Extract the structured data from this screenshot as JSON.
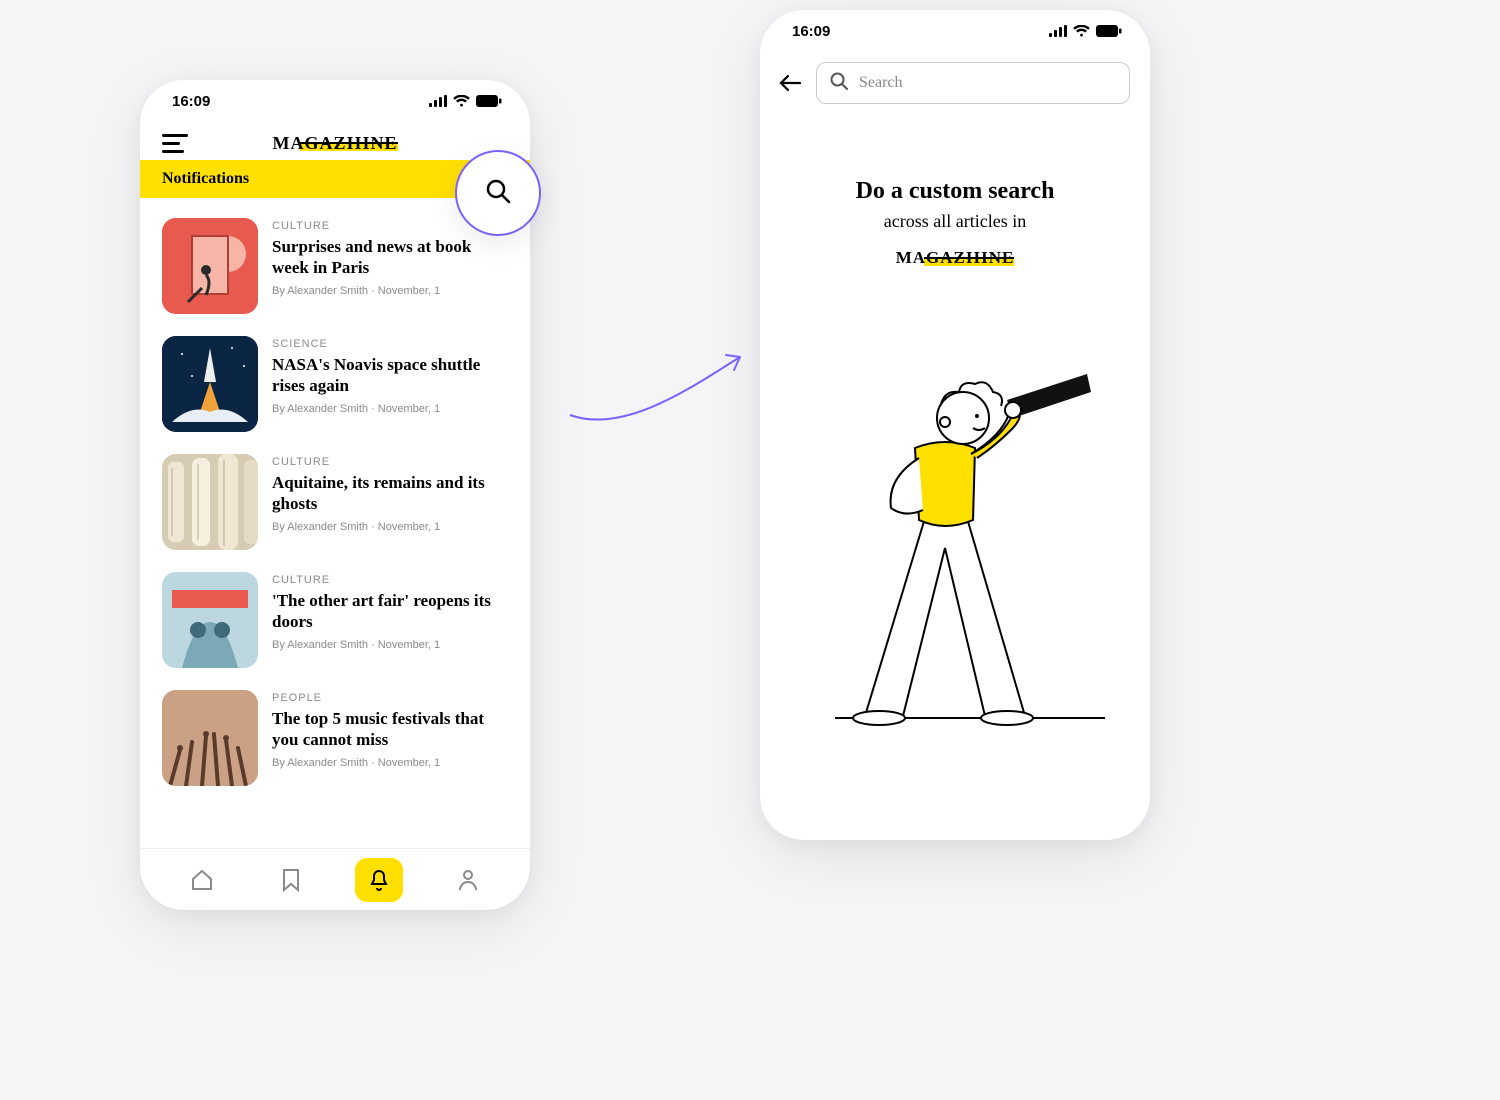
{
  "status": {
    "time": "16:09"
  },
  "brand": {
    "name": "MAGAZIIINE"
  },
  "left": {
    "notifications_label": "Notifications",
    "articles": [
      {
        "category": "CULTURE",
        "title": "Surprises and news at book week in Paris",
        "byline": "By Alexander Smith  ·  November, 1"
      },
      {
        "category": "SCIENCE",
        "title": "NASA's Noavis space shuttle rises again",
        "byline": "By Alexander Smith  ·  November, 1"
      },
      {
        "category": "CULTURE",
        "title": "Aquitaine, its remains and its ghosts",
        "byline": "By Alexander Smith  ·  November, 1"
      },
      {
        "category": "CULTURE",
        "title": "'The other art fair' reopens its doors",
        "byline": "By Alexander Smith  ·  November, 1"
      },
      {
        "category": "PEOPLE",
        "title": "The top 5 music festivals that you cannot miss",
        "byline": "By Alexander Smith  ·  November, 1"
      }
    ],
    "nav": {
      "icons": [
        "home",
        "bookmark",
        "bell",
        "user"
      ],
      "active": "bell"
    }
  },
  "right": {
    "search_placeholder": "Search",
    "hero_title": "Do a custom search",
    "hero_sub": "across all articles in"
  },
  "colors": {
    "accent_yellow": "#ffe000",
    "highlight_purple": "#7b61ff"
  }
}
